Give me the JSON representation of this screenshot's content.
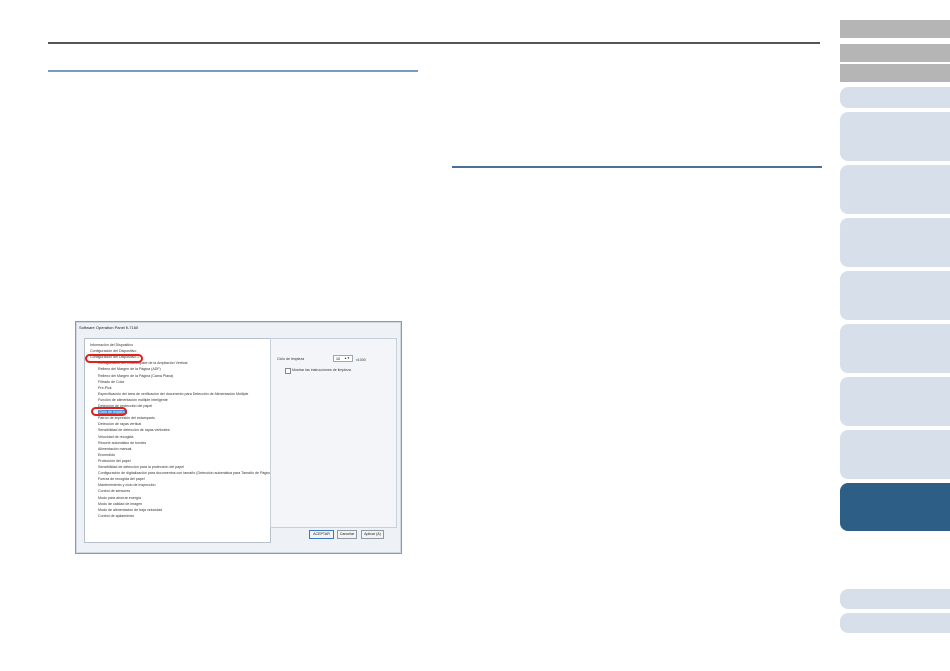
{
  "dialog": {
    "title": "Software Operation Panel fi-7160",
    "tree_items": [
      {
        "label": "Información del Dispositivo",
        "level": 1
      },
      {
        "label": "Configuración del Dispositivo",
        "level": 1
      },
      {
        "label": "Configuración del Dispositivo 2",
        "level": 1
      },
      {
        "label": "Configuración del Offset/Ajuste de la Ampliación Vertical",
        "level": 2
      },
      {
        "label": "Relleno del Margen de la Página (ADF)",
        "level": 2
      },
      {
        "label": "Relleno del Margen de la Página (Cama Plana)",
        "level": 2
      },
      {
        "label": "Filtrado de Color",
        "level": 2
      },
      {
        "label": "Pre-Pick",
        "level": 2
      },
      {
        "label": "Especificación del área de verificación del documento para Detección de Alimentación Múltiple",
        "level": 2
      },
      {
        "label": "Función de alimentación múltiple inteligente",
        "level": 2
      },
      {
        "label": "Detección de protección del papel",
        "level": 2
      },
      {
        "label": "Ciclo de limpieza",
        "level": 2
      },
      {
        "label": "Patrón de impresión del estampado",
        "level": 2
      },
      {
        "label": "Detección de rayas vertical",
        "level": 2
      },
      {
        "label": "Sensibilidad de detección de rayas verticales",
        "level": 2
      },
      {
        "label": "Velocidad de recogida",
        "level": 2
      },
      {
        "label": "Recorte automático de bordes",
        "level": 2
      },
      {
        "label": "Alimentación manual",
        "level": 2
      },
      {
        "label": "Encendido",
        "level": 2
      },
      {
        "label": "Protección del papel",
        "level": 2
      },
      {
        "label": "Sensibilidad de detección para la protección del papel",
        "level": 2
      },
      {
        "label": "Configuración de digitalización para documentos con tamaño (Detección automática para Tamaño de Página)",
        "level": 2
      },
      {
        "label": "Fuerza de recogida del papel",
        "level": 2
      },
      {
        "label": "Mantenimiento y ciclo de inspección",
        "level": 2
      },
      {
        "label": "Control de sensores",
        "level": 2
      },
      {
        "label": "Modo para ahorrar energía",
        "level": 2
      },
      {
        "label": "Modo de calidad de imagen",
        "level": 2
      },
      {
        "label": "Modo de alimentación de baja velocidad",
        "level": 2
      },
      {
        "label": "Control de apilamiento",
        "level": 2
      }
    ],
    "cleaning_cycle_label": "Ciclo de limpieza",
    "cleaning_cycle_value": "10",
    "cleaning_cycle_unit": "x1000",
    "show_instructions_label": "Mostrar las instrucciones de limpieza",
    "show_instructions_checked": false,
    "buttons": {
      "ok": "ACEPTAR",
      "cancel": "Cancelar",
      "apply": "Aplicar (A)"
    }
  },
  "highlight_color": "#e0201a",
  "accent_color": "#2d5f86"
}
